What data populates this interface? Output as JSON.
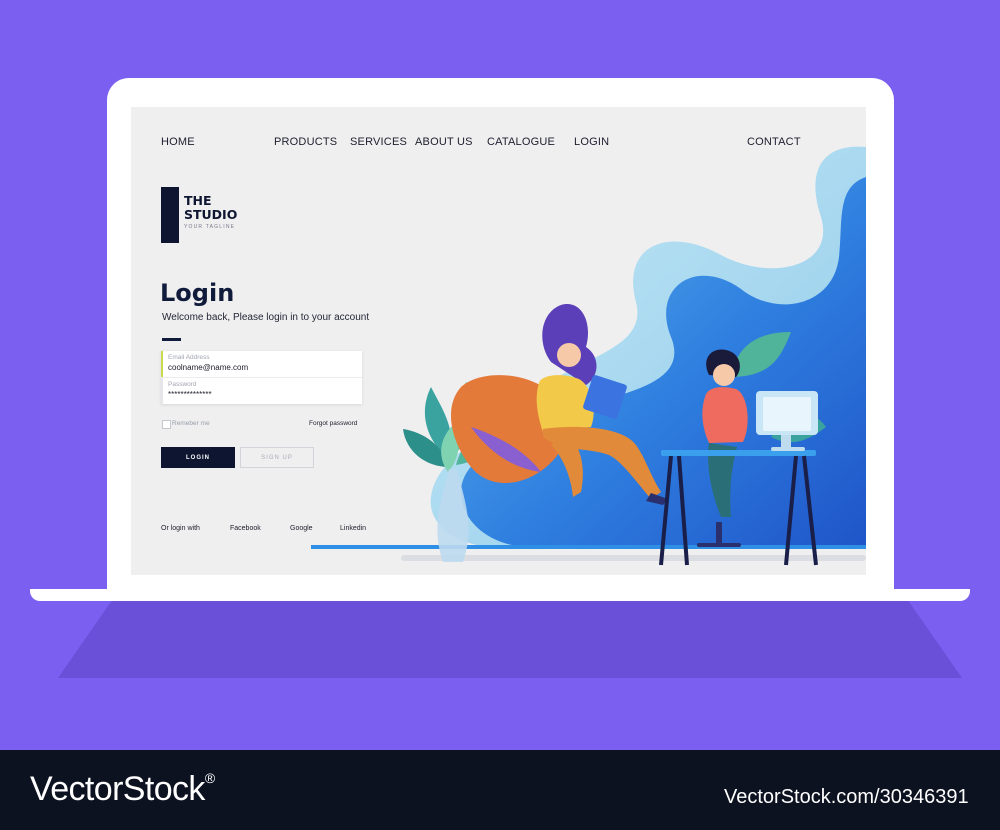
{
  "nav": {
    "home": "HOME",
    "products": "PRODUCTS",
    "services": "SERVICES",
    "about": "ABOUT US",
    "catalogue": "CATALOGUE",
    "login": "LOGIN",
    "contact": "CONTACT"
  },
  "logo": {
    "title": "THE\nSTUDIO",
    "tagline": "YOUR TAGLINE"
  },
  "form": {
    "title": "Login",
    "subtitle": "Welcome back, Please login in  to  your account",
    "email": {
      "label": "Email Address",
      "value": "coolname@name.com"
    },
    "password": {
      "label": "Password",
      "value": "**************"
    },
    "remember_label": "Remeber me",
    "forgot_label": "Forgot password",
    "login_button": "LOGIN",
    "signup_button": "SIGN UP"
  },
  "social": {
    "prefix": "Or  login with",
    "facebook": "Facebook",
    "google": "Google",
    "linkedin": "Linkedin"
  },
  "colors": {
    "background": "#7b5ff0",
    "screen": "#efeff0",
    "accent_blue": "#2f7fe0",
    "navy": "#0e1530"
  },
  "watermark": {
    "brand": "VectorStock",
    "registered": "®",
    "id": "VectorStock.com/30346391"
  }
}
